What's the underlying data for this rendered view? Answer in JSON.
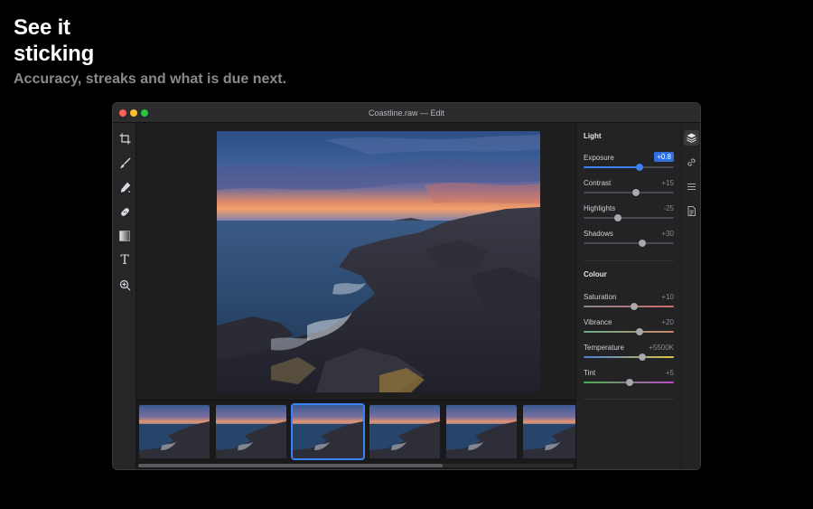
{
  "hero": {
    "title": "See it\nsticking",
    "subtitle": "Accuracy, streaks and what is due next."
  },
  "window": {
    "title": "Coastline.raw — Edit"
  },
  "tools": [
    {
      "name": "crop-icon",
      "glyph": "crop"
    },
    {
      "name": "brush-icon",
      "glyph": "brush"
    },
    {
      "name": "eyedropper-icon",
      "glyph": "eyedropper"
    },
    {
      "name": "healing-icon",
      "glyph": "healing"
    },
    {
      "name": "gradient-icon",
      "glyph": "gradient"
    },
    {
      "name": "text-icon",
      "glyph": "T"
    },
    {
      "name": "zoom-icon",
      "glyph": "zoom"
    }
  ],
  "panel": {
    "light": {
      "title": "Light",
      "adjustments": [
        {
          "label": "Exposure",
          "value": "+0.8",
          "level": 0.62,
          "highlight": true
        },
        {
          "label": "Contrast",
          "value": "+15",
          "level": 0.58
        },
        {
          "label": "Highlights",
          "value": "-25",
          "level": 0.38
        },
        {
          "label": "Shadows",
          "value": "+30",
          "level": 0.65
        }
      ]
    },
    "colour": {
      "title": "Colour",
      "adjustments": [
        {
          "label": "Saturation",
          "value": "+10",
          "level": 0.56
        },
        {
          "label": "Vibrance",
          "value": "+20",
          "level": 0.62
        },
        {
          "label": "Temperature",
          "value": "+5500K",
          "level": 0.65
        },
        {
          "label": "Tint",
          "value": "+5",
          "level": 0.51
        }
      ]
    }
  },
  "rail": [
    {
      "name": "layers-icon",
      "active": true
    },
    {
      "name": "link-icon",
      "active": false
    },
    {
      "name": "list-icon",
      "active": false
    },
    {
      "name": "document-icon",
      "active": false
    }
  ],
  "filmstrip": {
    "selected_index": 2,
    "count": 6,
    "scroll_fraction": 0.7
  },
  "colors": {
    "accent": "#3b82f6",
    "exposure_badge": "#2f6fe0"
  }
}
